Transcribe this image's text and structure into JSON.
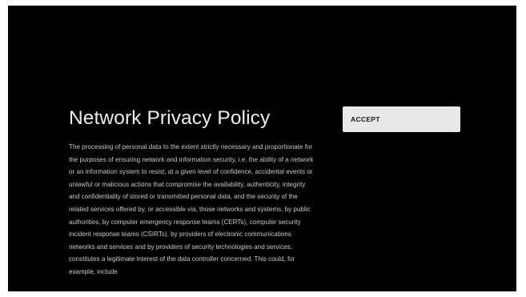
{
  "dialog": {
    "title": "Network Privacy Policy",
    "body": "The processing of personal data to the extent strictly necessary and proportionate for the purposes of ensuring network and information security, i.e. the ability of a network or an information system to resist, at a given level of confidence, accidental events or unlawful or malicious actions that compromise the availability, authenticity, integrity and confidentiality of stored or transmitted personal data, and the security of the related services offered by, or accessible via, those networks and systems, by public authorities, by computer emergency response teams (CERTs), computer security incident response teams (CSIRTs), by providers of electronic communications networks and services and by providers of security technologies and services, constitutes a legitimate interest of the data controller concerned. This could, for example, include"
  },
  "actions": {
    "accept_label": "ACCEPT"
  }
}
